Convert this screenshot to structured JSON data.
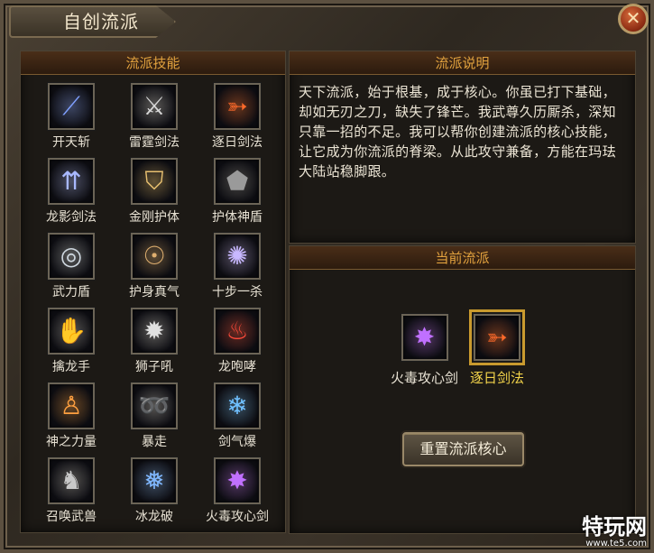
{
  "window": {
    "title": "自创流派",
    "close_symbol": "✕"
  },
  "skills_panel": {
    "header": "流派技能",
    "skills": [
      {
        "label": "开天斩",
        "icon": "blade-slash-icon",
        "glyph": "⟋",
        "color": "#7fa0ff"
      },
      {
        "label": "雷霆剑法",
        "icon": "thunder-sword-icon",
        "glyph": "⚔",
        "color": "#d9d9d9"
      },
      {
        "label": "逐日剑法",
        "icon": "sun-chase-sword-icon",
        "glyph": "➳",
        "color": "#ff6a2a"
      },
      {
        "label": "龙影剑法",
        "icon": "dragon-shadow-sword-icon",
        "glyph": "⇈",
        "color": "#a8b8ff"
      },
      {
        "label": "金刚护体",
        "icon": "diamond-guard-icon",
        "glyph": "⛉",
        "color": "#e8c070"
      },
      {
        "label": "护体神盾",
        "icon": "divine-shield-icon",
        "glyph": "⬟",
        "color": "#9a9a9a"
      },
      {
        "label": "武力盾",
        "icon": "force-shield-icon",
        "glyph": "◎",
        "color": "#cfd8e0"
      },
      {
        "label": "护身真气",
        "icon": "true-qi-icon",
        "glyph": "☉",
        "color": "#e0b070"
      },
      {
        "label": "十步一杀",
        "icon": "ten-step-kill-icon",
        "glyph": "✺",
        "color": "#c8b8ff"
      },
      {
        "label": "擒龙手",
        "icon": "dragon-grab-icon",
        "glyph": "✋",
        "color": "#d0d0d0"
      },
      {
        "label": "狮子吼",
        "icon": "lion-roar-icon",
        "glyph": "✹",
        "color": "#e0e0e0"
      },
      {
        "label": "龙咆哮",
        "icon": "dragon-roar-icon",
        "glyph": "♨",
        "color": "#ff4a3a"
      },
      {
        "label": "神之力量",
        "icon": "divine-power-icon",
        "glyph": "♙",
        "color": "#ffa040"
      },
      {
        "label": "暴走",
        "icon": "rampage-icon",
        "glyph": "➿",
        "color": "#cfcfcf"
      },
      {
        "label": "剑气爆",
        "icon": "sword-qi-burst-icon",
        "glyph": "❄",
        "color": "#70c0ff"
      },
      {
        "label": "召唤武兽",
        "icon": "summon-beast-icon",
        "glyph": "♞",
        "color": "#c8c8c8"
      },
      {
        "label": "冰龙破",
        "icon": "ice-dragon-icon",
        "glyph": "❅",
        "color": "#80b8ff"
      },
      {
        "label": "火毒攻心剑",
        "icon": "fire-poison-sword-icon",
        "glyph": "✸",
        "color": "#c070ff"
      }
    ]
  },
  "description_panel": {
    "header": "流派说明",
    "text": "天下流派，始于根基，成于核心。你虽已打下基础，却如无刃之刀，缺失了锋芒。我武尊久历厮杀，深知只靠一招的不足。我可以帮你创建流派的核心技能，让它成为你流派的脊梁。从此攻守兼备，方能在玛珐大陆站稳脚跟。"
  },
  "current_panel": {
    "header": "当前流派",
    "items": [
      {
        "label": "火毒攻心剑",
        "icon": "fire-poison-sword-icon",
        "glyph": "✸",
        "color": "#c070ff",
        "selected": false
      },
      {
        "label": "逐日剑法",
        "icon": "sun-chase-sword-icon",
        "glyph": "➳",
        "color": "#ff6a2a",
        "selected": true
      }
    ],
    "reset_button": "重置流派核心"
  },
  "watermark": {
    "main": "特玩网",
    "sub": "www.te5.com"
  }
}
